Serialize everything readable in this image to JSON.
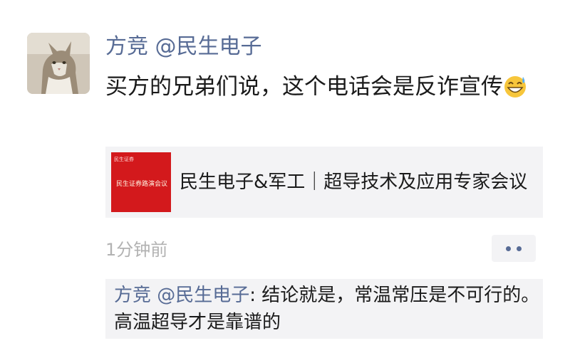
{
  "post": {
    "author": "方竞 @民生电子",
    "text": "买方的兄弟们说，这个电话会是反诈宣传",
    "emoji": "grinning-sweat-emoji",
    "timestamp": "1分钟前"
  },
  "link_card": {
    "thumbnail_logo": "民生证券",
    "thumbnail_title": "民生证券路演会议",
    "title": "民生电子&军工｜超导技术及应用专家会议"
  },
  "comments": [
    {
      "author": "方竞 @民生电子",
      "separator": ": ",
      "text": "结论就是，常温常压是不可行的。高温超导才是靠谱的"
    }
  ],
  "colors": {
    "link_blue": "#576b95",
    "card_bg": "#f3f3f5",
    "thumb_red": "#d3191c",
    "timestamp_gray": "#b2b2b2"
  }
}
